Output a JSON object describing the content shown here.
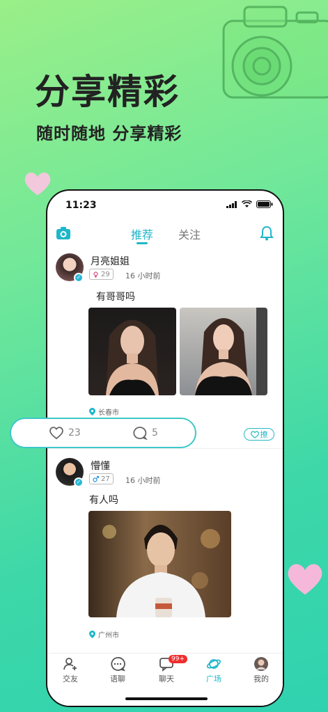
{
  "hero": {
    "title": "分享精彩",
    "subtitle": "随时随地 分享精彩"
  },
  "status_bar": {
    "time": "11:23"
  },
  "top_nav": {
    "tabs": [
      {
        "label": "推荐",
        "active": true
      },
      {
        "label": "关注",
        "active": false
      }
    ]
  },
  "posts": [
    {
      "username": "月亮姐姐",
      "gender": "female",
      "age": "29",
      "time_ago": "16 小时前",
      "content": "有哥哥吗",
      "location": "长春市",
      "likes": "23",
      "comments": "5",
      "flirt_label": "撩"
    },
    {
      "username": "懵懂",
      "gender": "male",
      "age": "27",
      "time_ago": "16 小时前",
      "content": "有人吗",
      "location": "广州市"
    }
  ],
  "bottom_nav": {
    "items": [
      {
        "label": "交友",
        "icon": "friends-icon"
      },
      {
        "label": "语聊",
        "icon": "voice-chat-icon"
      },
      {
        "label": "聊天",
        "icon": "chat-icon",
        "badge": "99+"
      },
      {
        "label": "广场",
        "icon": "planet-icon",
        "active": true
      },
      {
        "label": "我的",
        "icon": "avatar-icon"
      }
    ]
  },
  "colors": {
    "accent": "#1fb6c9",
    "badge": "#f02d2d",
    "bg_top": "#9aef88",
    "bg_bottom": "#2fd2b0"
  }
}
